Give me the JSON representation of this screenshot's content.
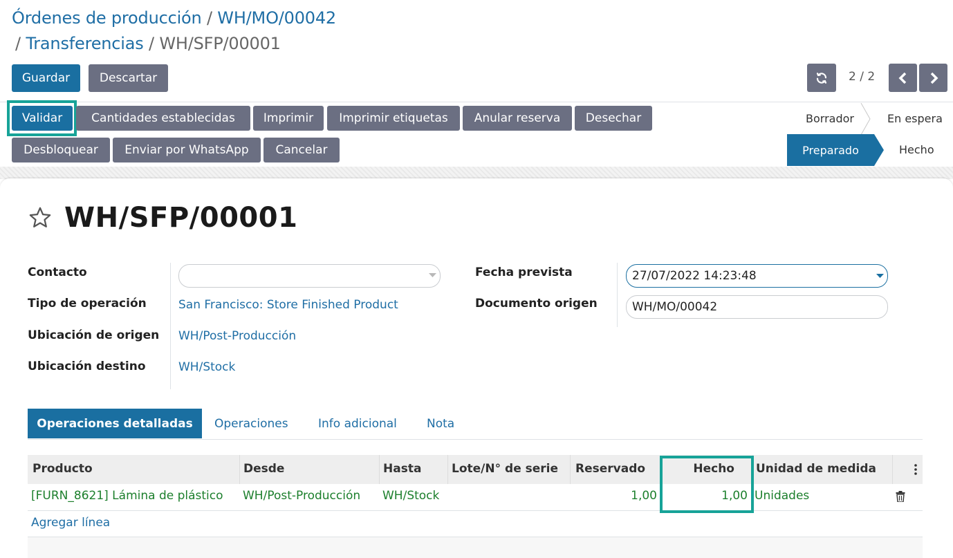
{
  "breadcrumb": {
    "items": [
      "Órdenes de producción",
      "WH/MO/00042",
      "Transferencias"
    ],
    "current": "WH/SFP/00001",
    "separator": "/"
  },
  "control_panel": {
    "save_label": "Guardar",
    "discard_label": "Descartar",
    "pager_value": "2 / 2",
    "refresh_icon": "refresh-icon",
    "prev_icon": "chevron-left-icon",
    "next_icon": "chevron-right-icon"
  },
  "actions": {
    "row1": [
      "Validar",
      "Cantidades establecidas",
      "Imprimir",
      "Imprimir etiquetas",
      "Anular reserva",
      "Desechar"
    ],
    "row2": [
      "Desbloquear",
      "Enviar por WhatsApp",
      "Cancelar"
    ]
  },
  "statusbar": {
    "steps": [
      "Borrador",
      "En espera",
      "Preparado",
      "Hecho"
    ],
    "active": "Preparado"
  },
  "record": {
    "title": "WH/SFP/00001",
    "favorite_icon": "star-outline-icon"
  },
  "fields": {
    "contact_label": "Contacto",
    "contact_value": "",
    "op_type_label": "Tipo de operación",
    "op_type_value": "San Francisco: Store Finished Product",
    "src_label": "Ubicación de origen",
    "src_value": "WH/Post-Producción",
    "dest_label": "Ubicación destino",
    "dest_value": "WH/Stock",
    "scheduled_label": "Fecha prevista",
    "scheduled_value": "27/07/2022 14:23:48",
    "origin_label": "Documento origen",
    "origin_value": "WH/MO/00042"
  },
  "tabs": [
    "Operaciones detalladas",
    "Operaciones",
    "Info adicional",
    "Nota"
  ],
  "table": {
    "columns": [
      "Producto",
      "Desde",
      "Hasta",
      "Lote/N° de serie",
      "Reservado",
      "Hecho",
      "Unidad de medida"
    ],
    "rows": [
      {
        "producto": "[FURN_8621] Lámina de plástico",
        "desde": "WH/Post-Producción",
        "hasta": "WH/Stock",
        "lote": "",
        "reservado": "1,00",
        "hecho": "1,00",
        "unidad": "Unidades"
      }
    ],
    "add_line": "Agregar línea"
  },
  "colors": {
    "primary": "#1a6fa1",
    "secondary": "#6b6f82",
    "highlight": "#17a398",
    "link": "#1f6ea5",
    "green": "#1c7f2c"
  }
}
